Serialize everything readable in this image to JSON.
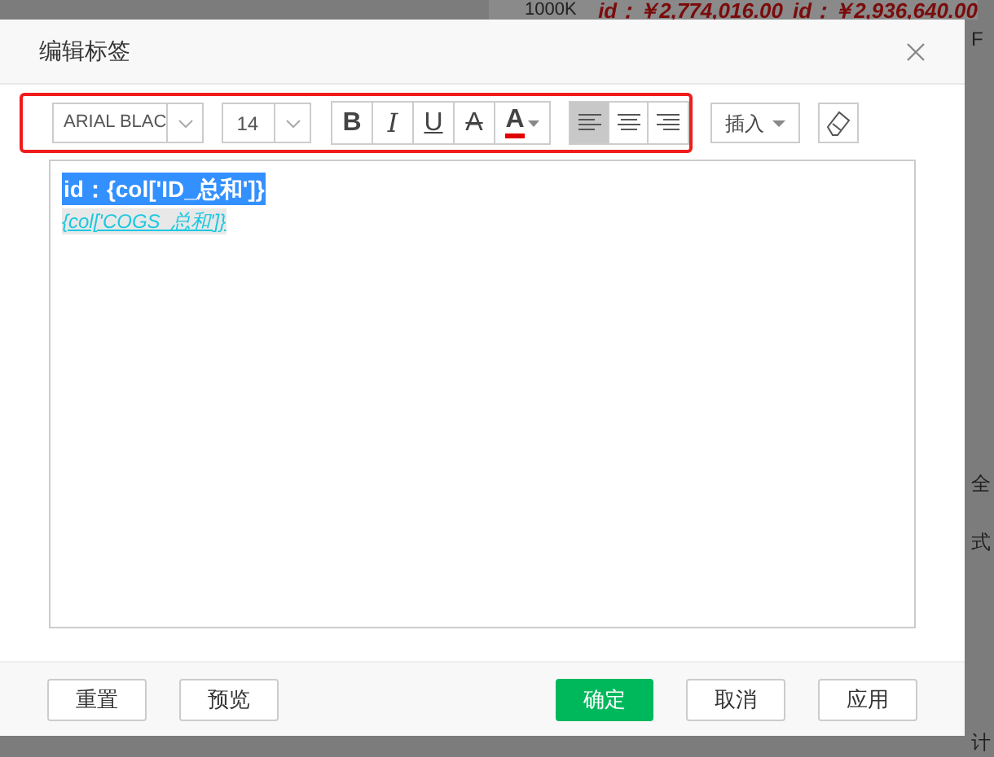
{
  "background": {
    "axis_label": "1000K",
    "value_labels": [
      "id：￥2,774,016.00",
      "id：￥2,936,640.00"
    ],
    "side_fragments": [
      "F",
      "全",
      "式",
      "计"
    ]
  },
  "dialog": {
    "title": "编辑标签",
    "toolbar": {
      "font": "ARIAL BLAC",
      "size": "14",
      "format_buttons": [
        {
          "kind": "bold",
          "label": "B",
          "on": false
        },
        {
          "kind": "italic",
          "label": "I",
          "on": false
        },
        {
          "kind": "underline",
          "label": "U",
          "on": false
        },
        {
          "kind": "strike",
          "label": "A",
          "on": false
        },
        {
          "kind": "color",
          "label": "A",
          "color": "#e00000"
        }
      ],
      "align_buttons": [
        {
          "kind": "left",
          "selected": true
        },
        {
          "kind": "center",
          "selected": false
        },
        {
          "kind": "right",
          "selected": false
        }
      ],
      "insert": "插入",
      "highlighted": true
    },
    "editor": {
      "lines": [
        {
          "text": "id：{col['ID_总和']}",
          "kind": "selected"
        },
        {
          "text": "{col['COGS_总和']}",
          "kind": "link"
        }
      ]
    },
    "buttons": [
      {
        "label": "重置",
        "kind": "default"
      },
      {
        "label": "预览",
        "kind": "default"
      },
      {
        "label": "确定",
        "kind": "primary"
      },
      {
        "label": "取消",
        "kind": "default"
      },
      {
        "label": "应用",
        "kind": "default"
      }
    ]
  }
}
